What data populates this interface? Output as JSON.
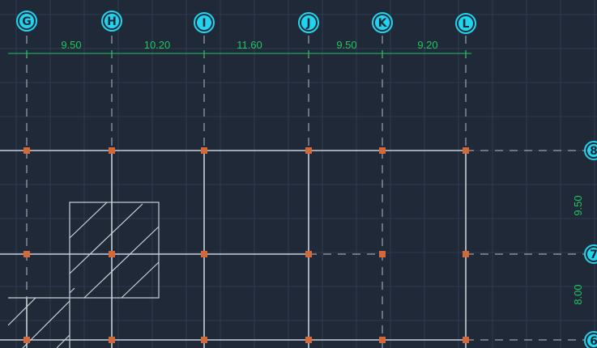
{
  "drawing": {
    "background_color": "#1f2937",
    "grid_color": "#34425a",
    "axis_line_color": "#c9d1d9",
    "column_marker_color": "#d2693b",
    "bubble_color": "#22d3ee",
    "dimension_color": "#22c55e",
    "column_grid_labels": [
      "G",
      "H",
      "I",
      "J",
      "K",
      "L"
    ],
    "row_grid_labels": [
      "8",
      "7",
      "6"
    ],
    "column_spacings": [
      "9.50",
      "10.20",
      "11.60",
      "9.50",
      "9.20"
    ],
    "row_spacings": [
      "9.50",
      "8.00"
    ]
  }
}
